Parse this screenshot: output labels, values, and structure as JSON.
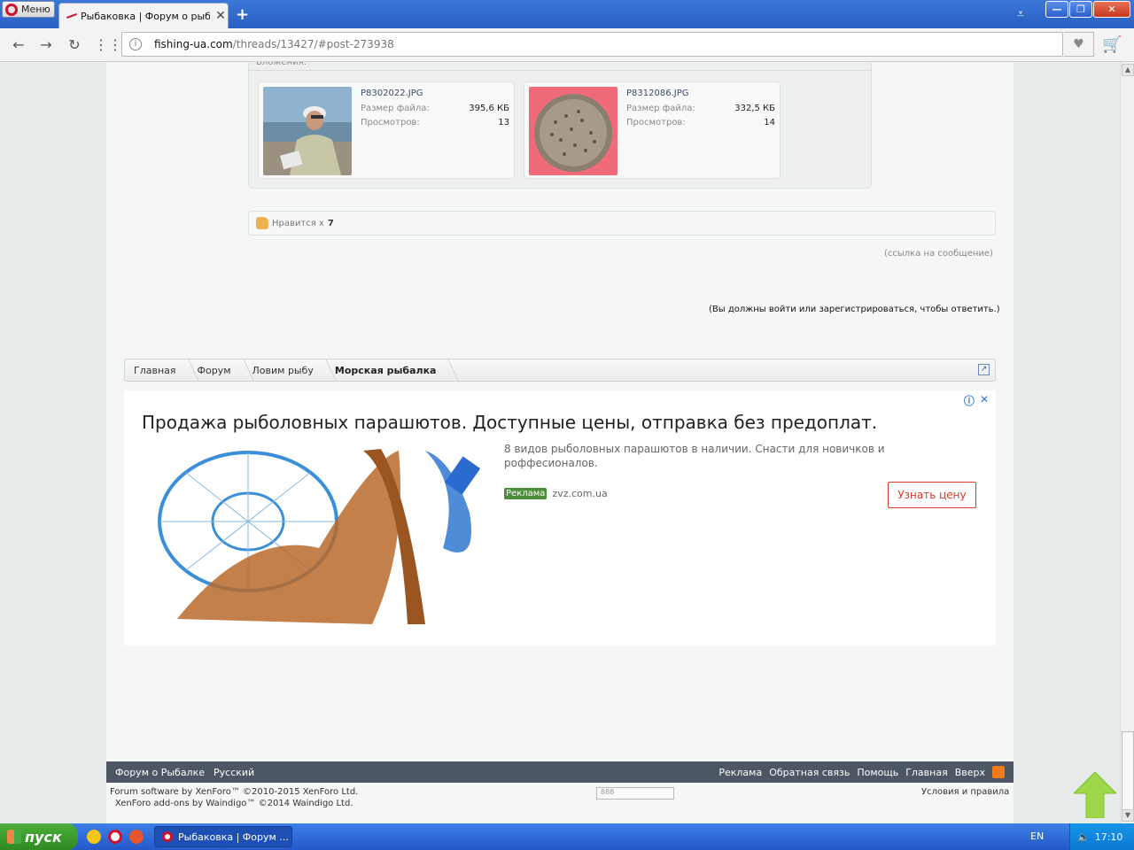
{
  "browser": {
    "menu_label": "Меню",
    "tab_title": "Рыбаковка | Форум о рыба",
    "tab_close": "✕",
    "new_tab": "+",
    "url_domain": "fishing-ua.com",
    "url_path": "/threads/13427/#post-273938"
  },
  "attachments": {
    "header": "Вложения:",
    "items": [
      {
        "name": "P8302022.JPG",
        "size_label": "Размер файла:",
        "size": "395,6 КБ",
        "views_label": "Просмотров:",
        "views": "13"
      },
      {
        "name": "P8312086.JPG",
        "size_label": "Размер файла:",
        "size": "332,5 КБ",
        "views_label": "Просмотров:",
        "views": "14"
      }
    ]
  },
  "likes": {
    "label": "Нравится х",
    "count": "7"
  },
  "permalink": "(ссылка на сообщение)",
  "must_login": "(Вы должны войти или зарегистрироваться, чтобы ответить.)",
  "breadcrumb": [
    "Главная",
    "Форум",
    "Ловим рыбу",
    "Морская рыбалка"
  ],
  "ad": {
    "title": "Продажа рыболовных парашютов. Доступные цены, отправка без предоплат.",
    "description": "8 видов рыболовных парашютов в наличии. Снасти для новичков и роффесионалов.",
    "tag": "Реклама",
    "domain": "zvz.com.ua",
    "cta": "Узнать цену"
  },
  "footer": {
    "left": [
      "Форум о Рыбалке",
      "Русский"
    ],
    "right": [
      "Реклама",
      "Обратная связь",
      "Помощь",
      "Главная",
      "Вверх"
    ],
    "copyright_1": "Forum software by XenForo™ ©2010-2015 XenForo Ltd.",
    "copyright_2": "XenForo add-ons by Waindigo™ ©2014 Waindigo Ltd.",
    "counter": "888",
    "terms": "Условия и правила"
  },
  "taskbar": {
    "start": "пуск",
    "task_title": "Рыбаковка | Форум ...",
    "lang": "EN",
    "time": "17:10"
  },
  "colors": {
    "accent": "#d0112b",
    "footer_bg": "#4d5663",
    "cta": "#d93a2a"
  }
}
